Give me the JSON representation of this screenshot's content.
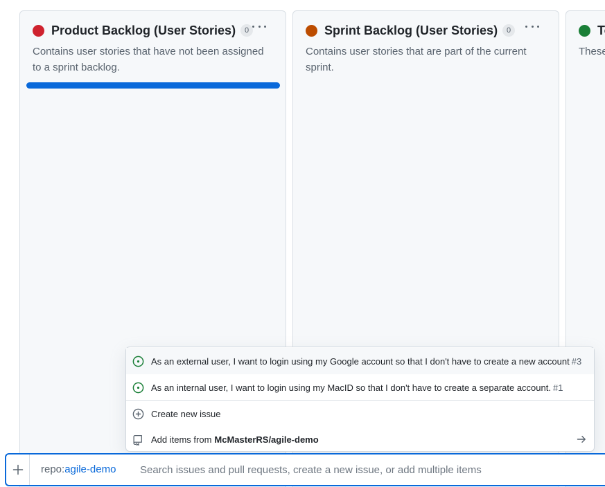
{
  "colors": {
    "backlog_dot": "#cf222e",
    "sprint_dot": "#bc4c00",
    "todo_dot": "#1a7f37",
    "accent": "#0969da",
    "issue_open": "#1a7f37"
  },
  "columns": [
    {
      "title": "Product Backlog (User Stories)",
      "count": "0",
      "description": "Contains user stories that have not been assigned to a sprint backlog.",
      "menu_icon": "kebab-horizontal-icon"
    },
    {
      "title": "Sprint Backlog (User Stories)",
      "count": "0",
      "description": "Contains user stories that are part of the current sprint.",
      "menu_icon": "kebab-horizontal-icon"
    },
    {
      "title": "To",
      "description": "These"
    }
  ],
  "suggestions": {
    "issues": [
      {
        "title": "As an external user, I want to login using my Google account so that I don't have to create a new account",
        "number": "#3",
        "icon": "issue-opened-icon"
      },
      {
        "title": "As an internal user, I want to login using my MacID so that I don't have to create a separate account.",
        "number": "#1",
        "icon": "issue-opened-icon"
      }
    ],
    "create_label": "Create new issue",
    "add_from_label": "Add items from",
    "add_from_repo": "McMasterRS/agile-demo"
  },
  "add_bar": {
    "filter_key": "repo:",
    "filter_value": "agile-demo",
    "placeholder": "Search issues and pull requests, create a new issue, or add multiple items"
  }
}
